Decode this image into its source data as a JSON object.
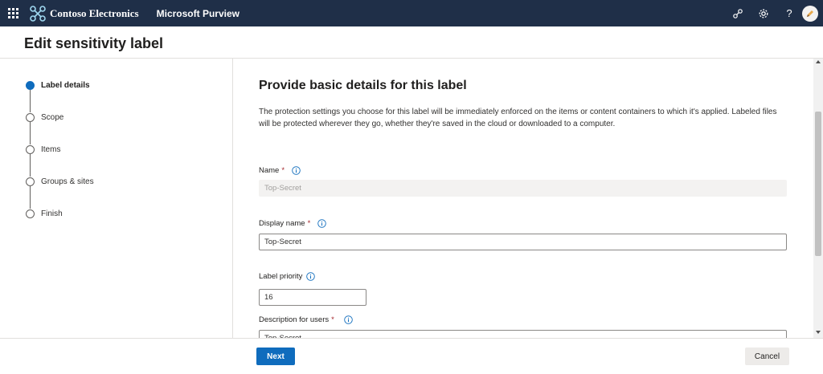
{
  "topbar": {
    "org_name": "Contoso Electronics",
    "app_name": "Microsoft Purview",
    "icons": [
      "waffle-icon",
      "contoso-logo-icon",
      "share-icon",
      "gear-icon",
      "help-icon",
      "avatar"
    ],
    "help_label": "?",
    "background": "#1f2f48"
  },
  "page": {
    "title": "Edit sensitivity label"
  },
  "stepper": {
    "steps": [
      {
        "label": "Label details",
        "active": true
      },
      {
        "label": "Scope",
        "active": false
      },
      {
        "label": "Items",
        "active": false
      },
      {
        "label": "Groups & sites",
        "active": false
      },
      {
        "label": "Finish",
        "active": false
      }
    ]
  },
  "main": {
    "heading": "Provide basic details for this label",
    "description": "The protection settings you choose for this label will be immediately enforced on the items or content containers to which it's applied. Labeled files will be protected wherever they go, whether they're saved in the cloud or downloaded to a computer.",
    "name": {
      "label": "Name",
      "required": "*",
      "value": "Top-Secret"
    },
    "display_name": {
      "label": "Display name",
      "required": "*",
      "value": "Top-Secret"
    },
    "label_priority": {
      "label": "Label priority",
      "value": "16"
    },
    "description_for_users": {
      "label": "Description for users",
      "required": "*",
      "value": "Top-Secret"
    }
  },
  "footer": {
    "next_label": "Next",
    "cancel_label": "Cancel"
  },
  "colors": {
    "accent": "#0f6cbd",
    "required": "#a4262c"
  }
}
